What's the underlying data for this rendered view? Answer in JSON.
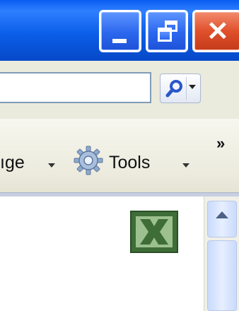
{
  "title_bar": {
    "buttons": [
      {
        "name": "minimize",
        "icon": "minimize-icon"
      },
      {
        "name": "restore",
        "icon": "restore-icon"
      },
      {
        "name": "close",
        "icon": "close-icon"
      }
    ],
    "close_glyph": "✕"
  },
  "search": {
    "input_value": "",
    "icon": "search-icon"
  },
  "command_bar": {
    "page_label": "ıge",
    "tools_label": "Tools",
    "tools_icon": "gear-icon",
    "chevron": "»"
  },
  "content": {
    "file_icon": "excel-icon"
  },
  "colors": {
    "titlebar_blue": "#0b5ee9",
    "close_red": "#e0502c",
    "excel_green": "#3e6d38"
  }
}
